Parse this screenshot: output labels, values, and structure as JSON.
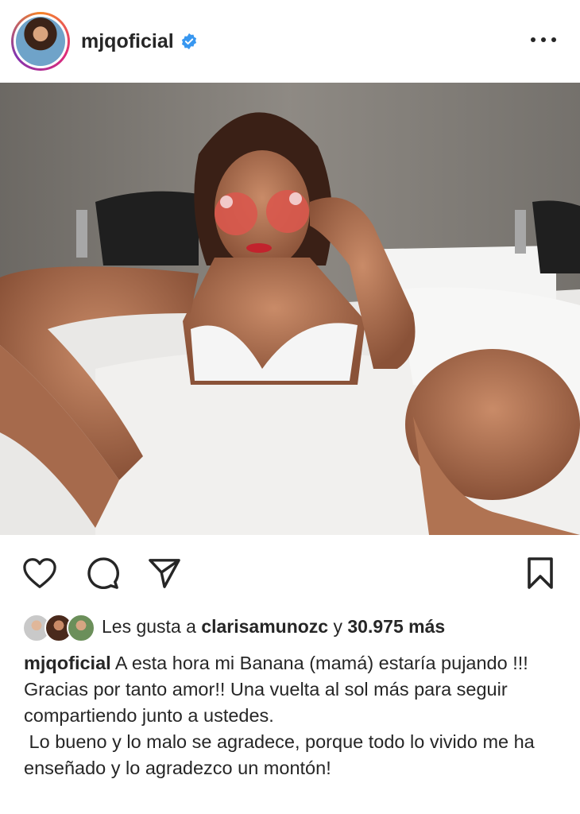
{
  "post": {
    "username": "mjqoficial",
    "verified": true,
    "likes": {
      "prefix": "Les gusta a",
      "liked_by": "clarisamunozc",
      "connector": "y",
      "count": "30.975 más"
    },
    "caption": {
      "username": "mjqoficial",
      "line1": "A esta hora mi Banana (mamá) estaría pujando !!!",
      "line2": "Gracias por tanto amor!! Una vuelta al sol más para seguir compartiendo junto a ustedes.",
      "line3": " Lo bueno y lo malo se agradece, porque todo lo vivido me ha enseñado y lo agradezco un montón!"
    }
  },
  "icons": [
    "more-options-icon",
    "verified-badge-icon",
    "heart-icon",
    "comment-icon",
    "share-icon",
    "bookmark-icon"
  ],
  "colors": {
    "verified_blue": "#3897f0",
    "text": "#262626",
    "story_ring": [
      "#f58529",
      "#dd2a7b",
      "#8134af"
    ]
  }
}
